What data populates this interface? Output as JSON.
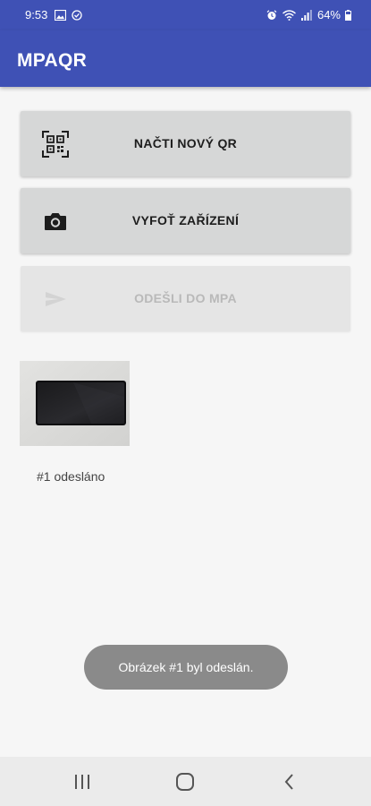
{
  "status_bar": {
    "time": "9:53",
    "battery": "64%",
    "left_icons": [
      "image-icon",
      "alert-circle-icon"
    ],
    "right_icons": [
      "alarm-icon",
      "wifi-icon",
      "signal-icon",
      "battery-icon"
    ]
  },
  "app_bar": {
    "title": "MPAQR",
    "color": "#3f51b5"
  },
  "buttons": [
    {
      "label": "NAČTI NOVÝ QR",
      "icon": "qr-code-icon",
      "enabled": true
    },
    {
      "label": "VYFOŤ ZAŘÍZENÍ",
      "icon": "camera-icon",
      "enabled": true
    },
    {
      "label": "ODEŠLI DO MPA",
      "icon": "send-icon",
      "enabled": false
    }
  ],
  "photos": [
    {
      "caption": "#1 odesláno"
    }
  ],
  "toast": {
    "message": "Obrázek #1 byl odeslán."
  },
  "nav_bar": {
    "items": [
      "recent-apps-icon",
      "home-icon",
      "back-icon"
    ]
  }
}
